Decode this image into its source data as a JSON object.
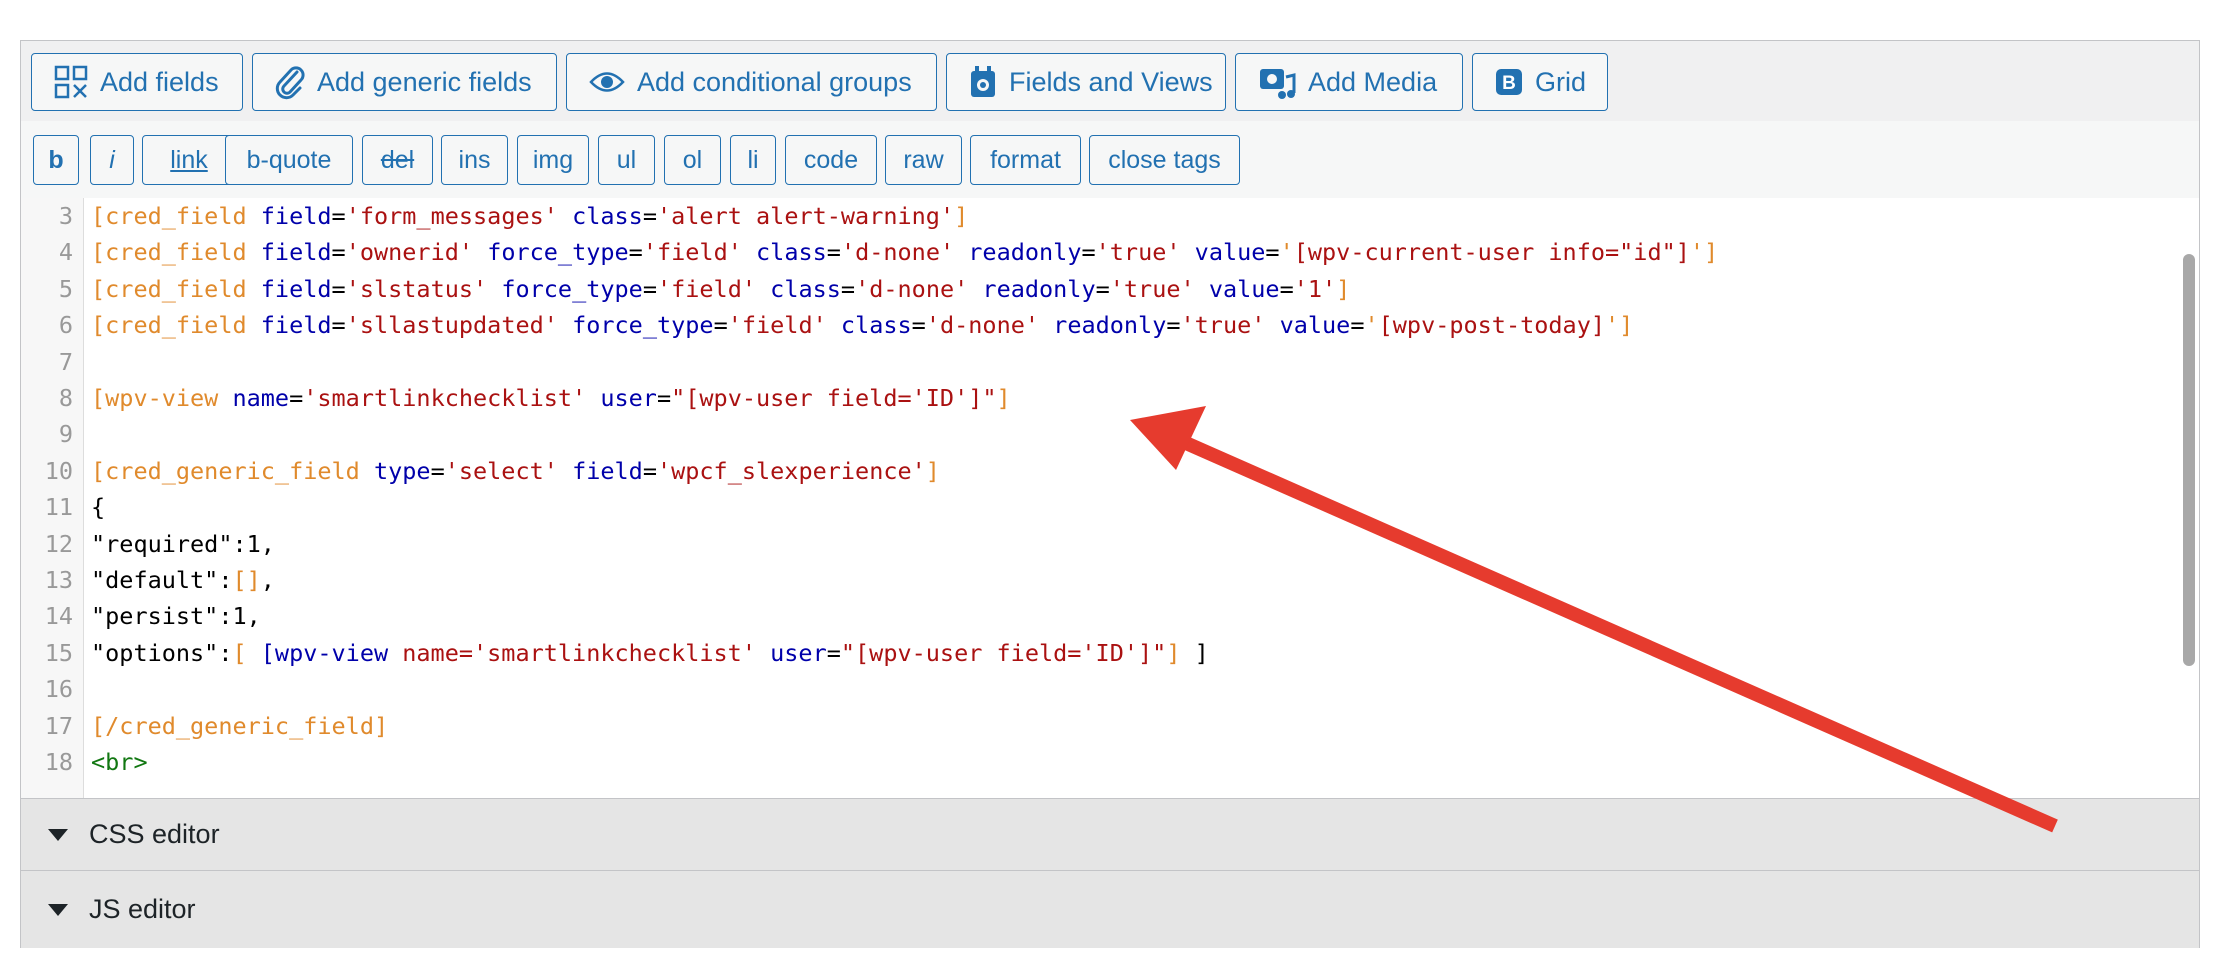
{
  "toolbar": {
    "buttons": [
      {
        "label": "Add fields",
        "icon": "fields-grid-icon"
      },
      {
        "label": "Add generic fields",
        "icon": "paperclip-icon"
      },
      {
        "label": "Add conditional groups",
        "icon": "eye-icon"
      },
      {
        "label": "Fields and Views",
        "icon": "calendar-icon"
      },
      {
        "label": "Add Media",
        "icon": "media-icon"
      },
      {
        "label": "Grid",
        "icon": "bootstrap-icon"
      }
    ]
  },
  "quicktags": [
    "b",
    "i",
    "link",
    "b-quote",
    "del",
    "ins",
    "img",
    "ul",
    "ol",
    "li",
    "code",
    "raw",
    "format",
    "close tags"
  ],
  "editor": {
    "lines": [
      {
        "n": "3",
        "tokens": [
          [
            "br",
            "[cred_field "
          ],
          [
            "at",
            "field"
          ],
          [
            "tx",
            "="
          ],
          [
            "st",
            "'form_messages'"
          ],
          [
            "tx",
            " "
          ],
          [
            "at",
            "class"
          ],
          [
            "tx",
            "="
          ],
          [
            "st",
            "'alert alert-warning'"
          ],
          [
            "br",
            "]"
          ]
        ]
      },
      {
        "n": "4",
        "tokens": [
          [
            "br",
            "[cred_field "
          ],
          [
            "at",
            "field"
          ],
          [
            "tx",
            "="
          ],
          [
            "st",
            "'ownerid'"
          ],
          [
            "tx",
            " "
          ],
          [
            "at",
            "force_type"
          ],
          [
            "tx",
            "="
          ],
          [
            "st",
            "'field'"
          ],
          [
            "tx",
            " "
          ],
          [
            "at",
            "class"
          ],
          [
            "tx",
            "="
          ],
          [
            "st",
            "'d-none'"
          ],
          [
            "tx",
            " "
          ],
          [
            "at",
            "readonly"
          ],
          [
            "tx",
            "="
          ],
          [
            "st",
            "'true'"
          ],
          [
            "tx",
            " "
          ],
          [
            "at",
            "value"
          ],
          [
            "tx",
            "="
          ],
          [
            "br",
            "'"
          ],
          [
            "st",
            "[wpv-current-user info=\"id\"]"
          ],
          [
            "br",
            "']"
          ]
        ]
      },
      {
        "n": "5",
        "tokens": [
          [
            "br",
            "[cred_field "
          ],
          [
            "at",
            "field"
          ],
          [
            "tx",
            "="
          ],
          [
            "st",
            "'slstatus'"
          ],
          [
            "tx",
            " "
          ],
          [
            "at",
            "force_type"
          ],
          [
            "tx",
            "="
          ],
          [
            "st",
            "'field'"
          ],
          [
            "tx",
            " "
          ],
          [
            "at",
            "class"
          ],
          [
            "tx",
            "="
          ],
          [
            "st",
            "'d-none'"
          ],
          [
            "tx",
            " "
          ],
          [
            "at",
            "readonly"
          ],
          [
            "tx",
            "="
          ],
          [
            "st",
            "'true'"
          ],
          [
            "tx",
            " "
          ],
          [
            "at",
            "value"
          ],
          [
            "tx",
            "="
          ],
          [
            "st",
            "'1'"
          ],
          [
            "br",
            "]"
          ]
        ]
      },
      {
        "n": "6",
        "tokens": [
          [
            "br",
            "[cred_field "
          ],
          [
            "at",
            "field"
          ],
          [
            "tx",
            "="
          ],
          [
            "st",
            "'sllastupdated'"
          ],
          [
            "tx",
            " "
          ],
          [
            "at",
            "force_type"
          ],
          [
            "tx",
            "="
          ],
          [
            "st",
            "'field'"
          ],
          [
            "tx",
            " "
          ],
          [
            "at",
            "class"
          ],
          [
            "tx",
            "="
          ],
          [
            "st",
            "'d-none'"
          ],
          [
            "tx",
            " "
          ],
          [
            "at",
            "readonly"
          ],
          [
            "tx",
            "="
          ],
          [
            "st",
            "'true'"
          ],
          [
            "tx",
            " "
          ],
          [
            "at",
            "value"
          ],
          [
            "tx",
            "="
          ],
          [
            "br",
            "'"
          ],
          [
            "st",
            "[wpv-post-today]"
          ],
          [
            "br",
            "']"
          ]
        ]
      },
      {
        "n": "7",
        "tokens": []
      },
      {
        "n": "8",
        "tokens": [
          [
            "br",
            "[wpv-view "
          ],
          [
            "at",
            "name"
          ],
          [
            "tx",
            "="
          ],
          [
            "st",
            "'smartlinkchecklist'"
          ],
          [
            "tx",
            " "
          ],
          [
            "at",
            "user"
          ],
          [
            "tx",
            "="
          ],
          [
            "st",
            "\"[wpv-user field='ID']\""
          ],
          [
            "br",
            "]"
          ]
        ]
      },
      {
        "n": "9",
        "tokens": []
      },
      {
        "n": "10",
        "tokens": [
          [
            "br",
            "[cred_generic_field "
          ],
          [
            "at",
            "type"
          ],
          [
            "tx",
            "="
          ],
          [
            "st",
            "'select'"
          ],
          [
            "tx",
            " "
          ],
          [
            "at",
            "field"
          ],
          [
            "tx",
            "="
          ],
          [
            "st",
            "'wpcf_slexperience'"
          ],
          [
            "br",
            "]"
          ]
        ]
      },
      {
        "n": "11",
        "tokens": [
          [
            "tx",
            "{"
          ]
        ]
      },
      {
        "n": "12",
        "tokens": [
          [
            "tx",
            "\"required\":1,"
          ]
        ]
      },
      {
        "n": "13",
        "tokens": [
          [
            "tx",
            "\"default\":"
          ],
          [
            "br",
            "[]"
          ],
          [
            "tx",
            ","
          ]
        ]
      },
      {
        "n": "14",
        "tokens": [
          [
            "tx",
            "\"persist\":1,"
          ]
        ]
      },
      {
        "n": "15",
        "tokens": [
          [
            "tx",
            "\"options\":"
          ],
          [
            "br",
            "[ "
          ],
          [
            "at",
            "[wpv-view "
          ],
          [
            "st",
            "name="
          ],
          [
            "st",
            "'smartlinkchecklist'"
          ],
          [
            "tx",
            " "
          ],
          [
            "at",
            "user"
          ],
          [
            "tx",
            "="
          ],
          [
            "st",
            "\"[wpv-user field='ID']\""
          ],
          [
            "br",
            "]"
          ],
          [
            "tx",
            " ]"
          ]
        ]
      },
      {
        "n": "16",
        "tokens": []
      },
      {
        "n": "17",
        "tokens": [
          [
            "br",
            "[/cred_generic_field]"
          ]
        ]
      },
      {
        "n": "18",
        "tokens": [
          [
            "tg",
            "<br>"
          ]
        ]
      }
    ]
  },
  "panels": {
    "css_label": "CSS editor",
    "js_label": "JS editor"
  },
  "annotation": {
    "color": "#e63b2e"
  }
}
